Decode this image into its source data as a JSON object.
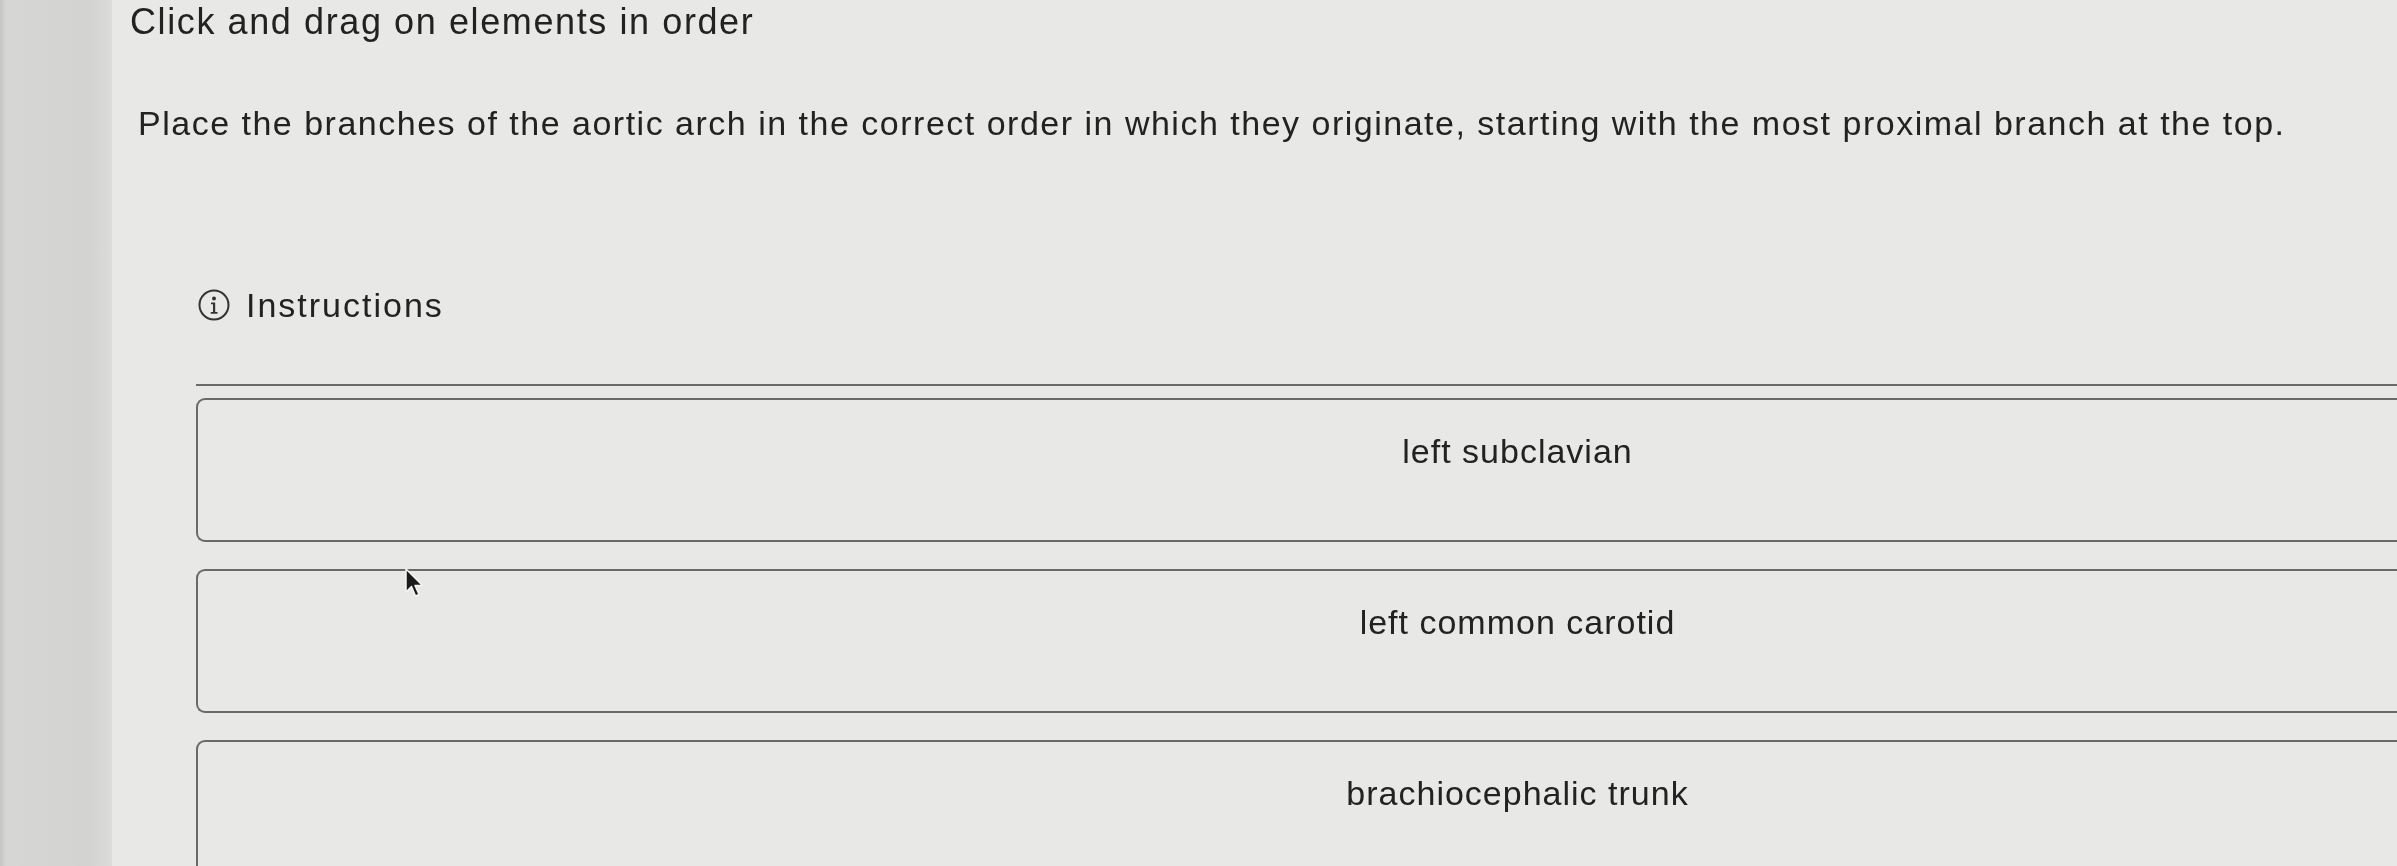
{
  "title": "Click and drag on elements in order",
  "prompt": "Place the branches of the aortic arch in the correct order in which they originate, starting with the most proximal branch at the top.",
  "instructions": {
    "label": "Instructions"
  },
  "items": [
    {
      "label": "left subclavian"
    },
    {
      "label": "left common carotid"
    },
    {
      "label": "brachiocephalic trunk"
    }
  ]
}
